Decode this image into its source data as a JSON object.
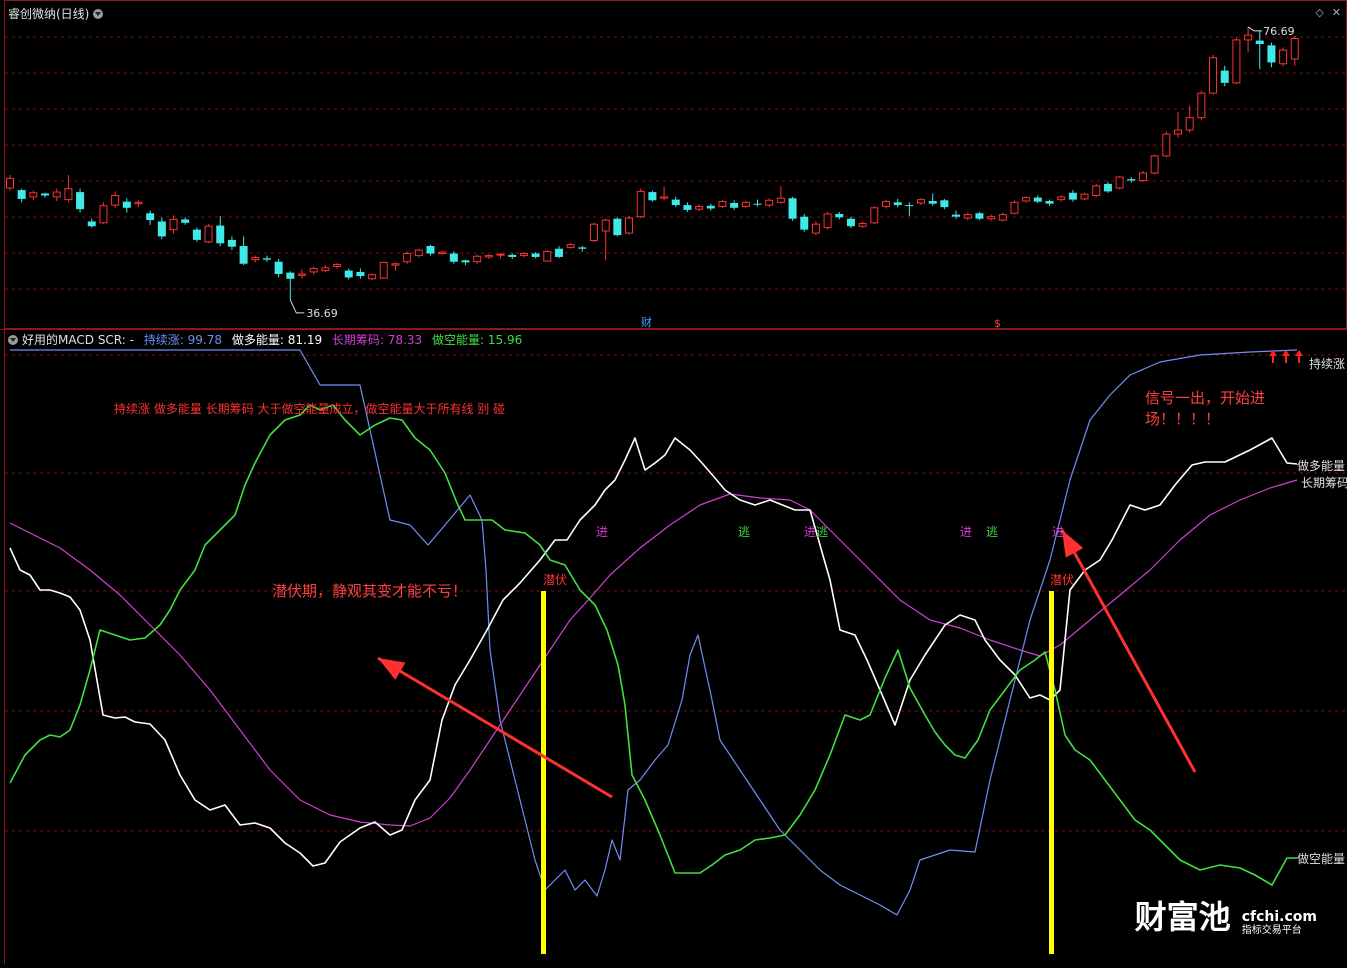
{
  "top_panel": {
    "title": "睿创微纳(日线)",
    "high_label": "76.69",
    "low_label": "36.69",
    "markers": [
      "财",
      "$"
    ],
    "candles": [
      [
        53.1,
        54.5,
        52.7,
        55.0
      ],
      [
        52.8,
        51.5,
        51.0,
        53.0
      ],
      [
        51.8,
        52.4,
        51.3,
        52.7
      ],
      [
        52.3,
        52.0,
        51.7,
        52.4
      ],
      [
        51.8,
        52.5,
        51.2,
        53.0
      ],
      [
        51.4,
        53.0,
        51.0,
        55.0
      ],
      [
        52.5,
        50.0,
        49.5,
        53.0
      ],
      [
        48.2,
        47.5,
        47.3,
        48.6
      ],
      [
        48.0,
        50.5,
        47.8,
        51.0
      ],
      [
        50.6,
        52.0,
        50.2,
        52.6
      ],
      [
        51.1,
        50.2,
        49.5,
        51.6
      ],
      [
        50.8,
        51.0,
        50.3,
        51.3
      ],
      [
        49.4,
        48.4,
        47.7,
        49.8
      ],
      [
        48.2,
        46.0,
        45.6,
        48.8
      ],
      [
        47.0,
        48.5,
        46.4,
        49.1
      ],
      [
        48.5,
        48.0,
        47.7,
        48.8
      ],
      [
        47.0,
        45.5,
        45.2,
        47.3
      ],
      [
        45.2,
        47.5,
        45.0,
        47.8
      ],
      [
        47.6,
        45.0,
        44.6,
        49.0
      ],
      [
        45.5,
        44.5,
        44.0,
        46.0
      ],
      [
        44.6,
        42.0,
        41.8,
        46.0
      ],
      [
        42.6,
        42.9,
        42.2,
        43.2
      ],
      [
        42.8,
        42.6,
        42.3,
        43.2
      ],
      [
        42.3,
        40.5,
        40.0,
        42.7
      ],
      [
        40.7,
        39.8,
        36.7,
        40.9
      ],
      [
        40.3,
        40.5,
        39.8,
        41.2
      ],
      [
        40.8,
        41.3,
        40.4,
        41.6
      ],
      [
        41.0,
        41.4,
        40.8,
        41.8
      ],
      [
        41.6,
        41.9,
        41.3,
        42.1
      ],
      [
        41.0,
        40.0,
        39.7,
        41.3
      ],
      [
        40.8,
        40.2,
        39.8,
        41.3
      ],
      [
        39.8,
        40.4,
        39.6,
        40.6
      ],
      [
        39.9,
        42.2,
        39.8,
        42.3
      ],
      [
        41.8,
        42.0,
        41.0,
        42.2
      ],
      [
        42.3,
        43.5,
        42.0,
        43.8
      ],
      [
        43.2,
        44.0,
        42.9,
        44.2
      ],
      [
        44.6,
        43.5,
        43.2,
        44.8
      ],
      [
        43.5,
        43.7,
        43.3,
        43.9
      ],
      [
        43.5,
        42.3,
        42.0,
        43.8
      ],
      [
        42.5,
        42.2,
        41.8,
        42.6
      ],
      [
        42.3,
        43.1,
        42.0,
        43.3
      ],
      [
        43.0,
        43.2,
        42.7,
        43.4
      ],
      [
        43.3,
        43.4,
        42.8,
        43.6
      ],
      [
        43.3,
        43.0,
        42.7,
        43.5
      ],
      [
        43.2,
        43.5,
        42.9,
        43.7
      ],
      [
        43.5,
        43.0,
        42.8,
        43.7
      ],
      [
        42.4,
        43.8,
        42.3,
        44.0
      ],
      [
        44.2,
        43.0,
        42.8,
        44.6
      ],
      [
        44.4,
        44.8,
        44.2,
        45.0
      ],
      [
        44.4,
        44.2,
        43.8,
        44.6
      ],
      [
        45.4,
        47.8,
        45.2,
        48.0
      ],
      [
        46.8,
        48.4,
        42.5,
        48.6
      ],
      [
        48.6,
        46.2,
        46.0,
        48.8
      ],
      [
        46.5,
        48.7,
        46.3,
        49.0
      ],
      [
        48.9,
        52.6,
        48.7,
        53.0
      ],
      [
        52.5,
        51.3,
        51.1,
        52.7
      ],
      [
        51.6,
        51.8,
        51.3,
        53.3
      ],
      [
        51.4,
        50.6,
        50.3,
        51.8
      ],
      [
        50.6,
        49.9,
        49.6,
        51.0
      ],
      [
        50.0,
        50.4,
        49.7,
        50.7
      ],
      [
        50.5,
        50.1,
        49.8,
        50.8
      ],
      [
        50.4,
        51.1,
        50.2,
        51.4
      ],
      [
        50.9,
        50.2,
        49.9,
        51.3
      ],
      [
        50.4,
        51.0,
        50.2,
        51.2
      ],
      [
        50.8,
        50.7,
        50.4,
        51.4
      ],
      [
        50.6,
        51.3,
        50.3,
        51.6
      ],
      [
        51.0,
        51.6,
        50.8,
        53.4
      ],
      [
        51.6,
        48.6,
        48.3,
        51.8
      ],
      [
        48.9,
        47.0,
        46.7,
        49.3
      ],
      [
        46.5,
        47.8,
        46.2,
        48.2
      ],
      [
        47.3,
        49.3,
        47.0,
        49.6
      ],
      [
        49.3,
        48.8,
        48.5,
        49.6
      ],
      [
        48.6,
        47.5,
        47.2,
        48.9
      ],
      [
        47.5,
        47.9,
        47.2,
        48.2
      ],
      [
        48.0,
        50.2,
        47.8,
        50.4
      ],
      [
        50.4,
        51.1,
        50.1,
        51.4
      ],
      [
        51.0,
        50.6,
        50.3,
        51.5
      ],
      [
        50.6,
        50.5,
        49.0,
        51.0
      ],
      [
        50.9,
        51.4,
        50.6,
        51.6
      ],
      [
        51.2,
        50.8,
        50.5,
        52.3
      ],
      [
        51.3,
        50.3,
        50.0,
        51.5
      ],
      [
        49.2,
        48.9,
        48.6,
        49.8
      ],
      [
        48.7,
        49.2,
        48.4,
        49.5
      ],
      [
        49.4,
        48.6,
        48.4,
        49.6
      ],
      [
        48.6,
        48.9,
        48.3,
        49.2
      ],
      [
        48.4,
        49.2,
        48.2,
        49.5
      ],
      [
        49.4,
        51.0,
        49.2,
        51.3
      ],
      [
        51.2,
        51.7,
        51.0,
        51.9
      ],
      [
        51.7,
        51.1,
        50.9,
        52.0
      ],
      [
        51.2,
        50.8,
        50.5,
        51.4
      ],
      [
        51.4,
        51.8,
        51.1,
        52.0
      ],
      [
        52.4,
        51.4,
        51.1,
        52.8
      ],
      [
        51.5,
        52.2,
        51.3,
        52.4
      ],
      [
        52.0,
        53.4,
        51.8,
        53.7
      ],
      [
        53.7,
        52.6,
        52.4,
        54.0
      ],
      [
        53.1,
        54.7,
        52.9,
        54.9
      ],
      [
        54.4,
        54.2,
        53.9,
        54.7
      ],
      [
        54.2,
        55.3,
        54.0,
        55.6
      ],
      [
        55.3,
        57.8,
        55.1,
        58.0
      ],
      [
        57.8,
        61.0,
        57.6,
        61.4
      ],
      [
        61.0,
        61.6,
        60.5,
        64.2
      ],
      [
        61.6,
        63.4,
        61.2,
        65.2
      ],
      [
        63.4,
        67.0,
        63.0,
        67.4
      ],
      [
        67.0,
        72.2,
        66.8,
        72.6
      ],
      [
        70.3,
        68.5,
        68.0,
        71.0
      ],
      [
        68.5,
        74.8,
        68.3,
        75.2
      ],
      [
        74.8,
        75.5,
        73.0,
        76.7
      ],
      [
        74.7,
        74.2,
        70.5,
        76.2
      ],
      [
        74.0,
        71.5,
        70.8,
        74.4
      ],
      [
        71.3,
        73.3,
        70.9,
        73.7
      ],
      [
        72.0,
        75.0,
        71.0,
        75.4
      ]
    ]
  },
  "bottom_panel": {
    "title": "好用的MACD",
    "scr_label": "SCR: -",
    "legend": [
      {
        "name": "持续涨",
        "value": "99.78",
        "color": "#6f8ff5"
      },
      {
        "name": "做多能量",
        "value": "81.19",
        "color": "#ffffff"
      },
      {
        "name": "长期筹码",
        "value": "78.33",
        "color": "#d040d0"
      },
      {
        "name": "做空能量",
        "value": "15.96",
        "color": "#40e040"
      }
    ],
    "right_labels": [
      "持续涨",
      "做多能量",
      "长期筹码",
      "做空能量"
    ],
    "signals": {
      "enter": [
        "进",
        "进",
        "进",
        "进"
      ],
      "escape": [
        "逃",
        "逃",
        "逃"
      ],
      "latent": [
        "潜伏",
        "潜伏"
      ]
    },
    "notes": {
      "rule": "持续涨 做多能量 长期筹码 大于做空能量成立，做空能量大于所有线 别 碰",
      "latent_note": "潜伏期，静观其变才能不亏！",
      "signal_note_1": "信号一出，开始进",
      "signal_note_2": "场！！！！"
    }
  },
  "watermark": {
    "brand": "财富池",
    "domain": "cfchi.com",
    "tagline": "指标交易平台"
  },
  "colors": {
    "grid": "#7a1010",
    "border": "#8a1a1a",
    "up": "#ff3030",
    "down": "#40e8e8",
    "annotation": "#ff3030",
    "highlight_bar": "#ffff00"
  }
}
